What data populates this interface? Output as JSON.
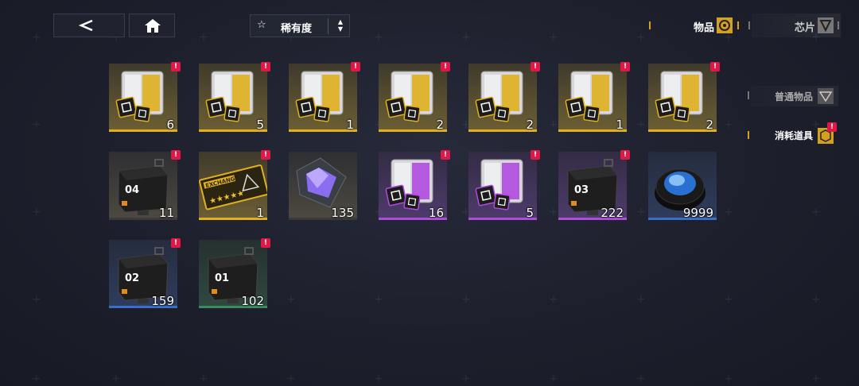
{
  "header": {
    "back_icon": "back-arrow-icon",
    "home_icon": "home-icon",
    "sort_label": "稀有度",
    "tabs": [
      {
        "label": "物品",
        "icon": "items-icon",
        "active": true
      },
      {
        "label": "芯片",
        "icon": "chip-icon",
        "active": false
      }
    ]
  },
  "side_tabs": [
    {
      "label": "普通物品",
      "icon": "common-items-icon",
      "active": false
    },
    {
      "label": "消耗道具",
      "icon": "consumables-icon",
      "active": true,
      "badge": "!"
    }
  ],
  "items": [
    {
      "kind": "chip-crate",
      "rarity": "gold",
      "qty": "6",
      "badge": "!"
    },
    {
      "kind": "chip-crate",
      "rarity": "gold",
      "qty": "5",
      "badge": "!"
    },
    {
      "kind": "chip-crate",
      "rarity": "gold",
      "qty": "1",
      "badge": "!"
    },
    {
      "kind": "chip-crate",
      "rarity": "gold",
      "qty": "2",
      "badge": "!"
    },
    {
      "kind": "chip-crate",
      "rarity": "gold",
      "qty": "2",
      "badge": "!"
    },
    {
      "kind": "chip-crate",
      "rarity": "gold",
      "qty": "1",
      "badge": "!"
    },
    {
      "kind": "chip-crate",
      "rarity": "gold",
      "qty": "2",
      "badge": "!"
    },
    {
      "kind": "supply-box",
      "rarity": "black",
      "qty": "11",
      "badge": "!",
      "number": "04"
    },
    {
      "kind": "exchange-ticket",
      "rarity": "gold",
      "qty": "1",
      "badge": "!",
      "ticket_text": "EXCHANGE"
    },
    {
      "kind": "crystal-core",
      "rarity": "black",
      "qty": "135",
      "badge": ""
    },
    {
      "kind": "chip-crate",
      "rarity": "purple",
      "qty": "16",
      "badge": "!"
    },
    {
      "kind": "chip-crate",
      "rarity": "purple",
      "qty": "5",
      "badge": "!"
    },
    {
      "kind": "supply-box",
      "rarity": "purple",
      "qty": "222",
      "badge": "!",
      "number": "03"
    },
    {
      "kind": "lens-disc",
      "rarity": "blue",
      "qty": "9999",
      "badge": ""
    },
    {
      "kind": "supply-box",
      "rarity": "blue",
      "qty": "159",
      "badge": "!",
      "number": "02"
    },
    {
      "kind": "supply-box",
      "rarity": "green",
      "qty": "102",
      "badge": "!",
      "number": "01"
    }
  ],
  "colors": {
    "gold": "#e0b020",
    "purple": "#b04be0",
    "blue": "#3a6ec8",
    "green": "#3c8a60",
    "black": "#3a3a3a",
    "badge": "#e01848",
    "accent": "#d4a020"
  }
}
